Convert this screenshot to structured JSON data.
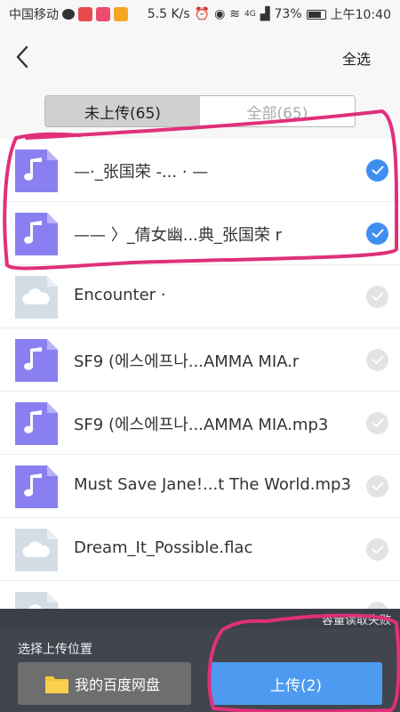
{
  "status_bar": {
    "carrier": "中国移动",
    "speed": "5.5 K/s",
    "signal": "4G",
    "battery": "73%",
    "time": "上午10:40"
  },
  "header": {
    "back_icon": "chevron-left-icon",
    "title": "",
    "select_all": "全选"
  },
  "tabs": [
    {
      "label": "未上传(65)",
      "active": true
    },
    {
      "label": "全部(65)",
      "active": false
    }
  ],
  "files": [
    {
      "name": "—·_张国荣 -...  ·  —",
      "type": "audio",
      "selected": true
    },
    {
      "name": "—— 〉_倩女幽...典_张国荣 r",
      "type": "audio",
      "selected": true
    },
    {
      "name": "Encounter ·",
      "type": "cloud",
      "selected": false
    },
    {
      "name": "SF9 (에스에프나...AMMA MIA.r",
      "type": "audio",
      "selected": false
    },
    {
      "name": "SF9 (에스에프나...AMMA MIA.mp3",
      "type": "audio",
      "selected": false
    },
    {
      "name": "Must Save Jane!...t The World.mp3",
      "type": "audio",
      "selected": false
    },
    {
      "name": "Dream_It_Possible.flac",
      "type": "cloud",
      "selected": false
    },
    {
      "name": "",
      "type": "cloud",
      "selected": false
    }
  ],
  "bottom": {
    "error_tip": "容量读取失败",
    "location_label": "选择上传位置",
    "location_button": "我的百度网盘",
    "upload_button": "上传(2)"
  },
  "colors": {
    "accent": "#3f8ff1",
    "audio_icon": "#8a7ff0",
    "cloud_icon": "#d4dde5",
    "annotation": "#e0307a"
  }
}
